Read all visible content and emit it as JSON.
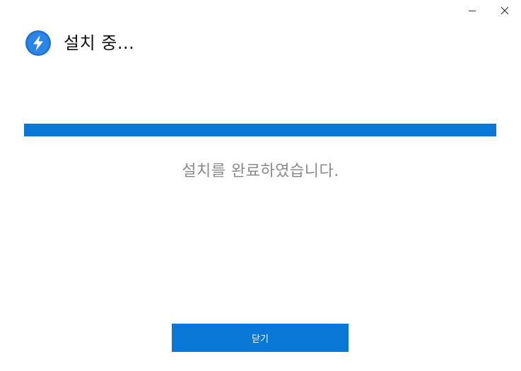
{
  "window": {
    "controls": {
      "minimize_icon": "minimize-icon",
      "close_icon": "close-icon"
    }
  },
  "header": {
    "icon": "lightning-bolt-icon",
    "title": "설치 중..."
  },
  "progress": {
    "value_percent": 100
  },
  "status": {
    "message": "설치를 완료하였습니다."
  },
  "footer": {
    "close_label": "닫기"
  },
  "colors": {
    "accent": "#0A78D7",
    "status_text": "#8A8A8A"
  }
}
